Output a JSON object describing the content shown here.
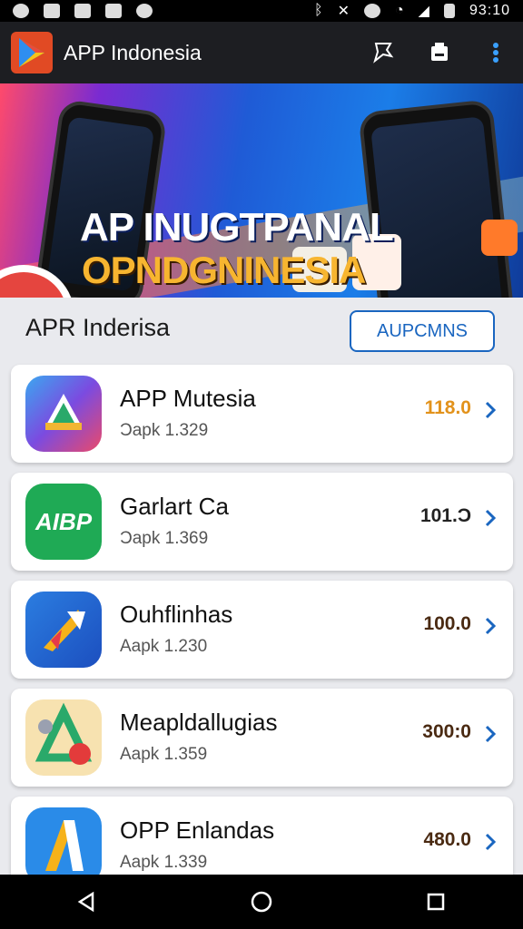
{
  "status": {
    "time": "93:10"
  },
  "appbar": {
    "title": "APP Indonesia"
  },
  "banner": {
    "line1": "AP INUGTPANAL",
    "line2": "OPNDGNINESIA"
  },
  "section": {
    "title": "APR Inderisa",
    "button": "AUPCMNS"
  },
  "apps": [
    {
      "name": "APP Mutesia",
      "sub": "Ɔapk 1.329",
      "price": "118.0",
      "price_color": "#e2921b"
    },
    {
      "name": "Garlart Ca",
      "sub": "Ɔapk 1.369",
      "price": "101.Ɔ",
      "price_color": "#222222",
      "icon_text": "AIBP"
    },
    {
      "name": "Ouhflinhas",
      "sub": "Aapk 1.230",
      "price": "100.0",
      "price_color": "#4a2a12"
    },
    {
      "name": "Meapldallugias",
      "sub": "Aapk 1.359",
      "price": "300:0",
      "price_color": "#4a2a12"
    },
    {
      "name": "OPP Enlandas",
      "sub": "Aapk 1.339",
      "price": "480.0",
      "price_color": "#4a2a12"
    }
  ],
  "icons": {
    "appbar": [
      "bookmark-star-icon",
      "storefront-icon",
      "more-vert-icon"
    ],
    "nav": [
      "back-icon",
      "home-icon",
      "recents-icon"
    ],
    "accent": "#1a66c0"
  }
}
